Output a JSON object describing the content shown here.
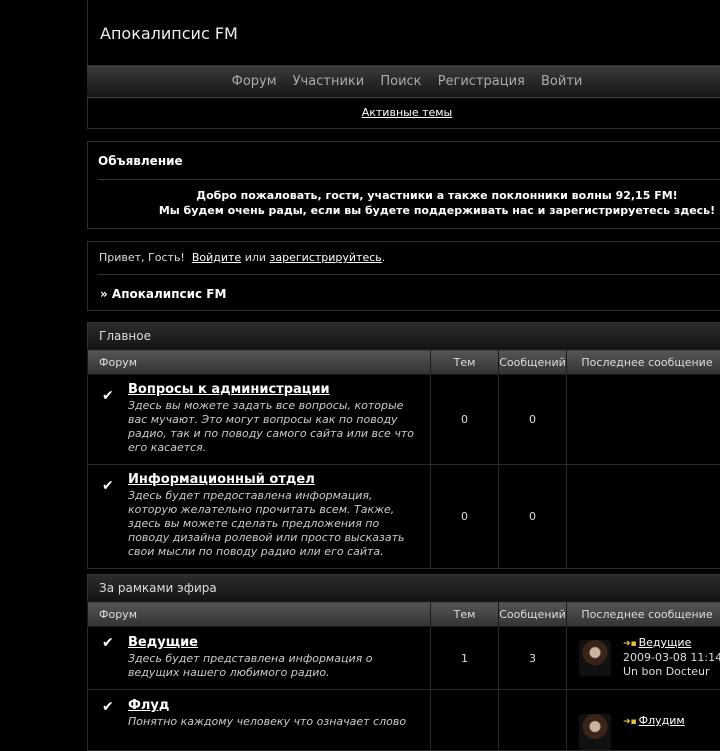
{
  "header": {
    "title": "Апокалипсис FM"
  },
  "nav": [
    "Форум",
    "Участники",
    "Поиск",
    "Регистрация",
    "Войти"
  ],
  "active_topics": "Активные темы",
  "announcement": {
    "title": "Объявление",
    "line1": "Добро пожаловать, гости, участники а также поклонники волны 92,15 FM!",
    "line2": "Мы будем очень рады, если вы будете поддерживать нас и зарегистрируетесь здесь!"
  },
  "greeting": {
    "prefix": "Привет, Гость!",
    "login": "Войдите",
    "or": "или",
    "register": "зарегистрируйтесь",
    "suffix": "."
  },
  "breadcrumb": "» Апокалипсис FM",
  "columns": {
    "forum": "Форум",
    "topics": "Тем",
    "posts": "Сообщений",
    "last": "Последнее сообщение"
  },
  "categories": [
    {
      "title": "Главное",
      "forums": [
        {
          "title": "Вопросы к администрации",
          "desc": "Здесь вы можете задать все вопросы, которые вас мучают. Это могут вопросы как по поводу радио, так и по поводу самого сайта или все что его касается.",
          "topics": "0",
          "posts": "0"
        },
        {
          "title": "Информационный отдел",
          "desc": "Здесь будет предоставлена информация, которую желательно прочитать всем. Также, здесь вы можете сделать предложения по поводу дизайна ролевой или просто высказать свои мысли по поводу радио или его сайта.",
          "topics": "0",
          "posts": "0"
        }
      ]
    },
    {
      "title": "За рамками эфира",
      "forums": [
        {
          "title": "Ведущие",
          "desc": "Здесь будет представлена информация о ведущих нашего любимого радио.",
          "topics": "1",
          "posts": "3",
          "last_topic": "Ведущие",
          "last_date": "2009-03-08 11:14",
          "last_author": "Un bon Docteur"
        },
        {
          "title": "Флуд",
          "desc": "Понятно каждому человеку что означает слово",
          "topics": "",
          "posts": "",
          "last_topic": "Флудим"
        }
      ]
    }
  ]
}
